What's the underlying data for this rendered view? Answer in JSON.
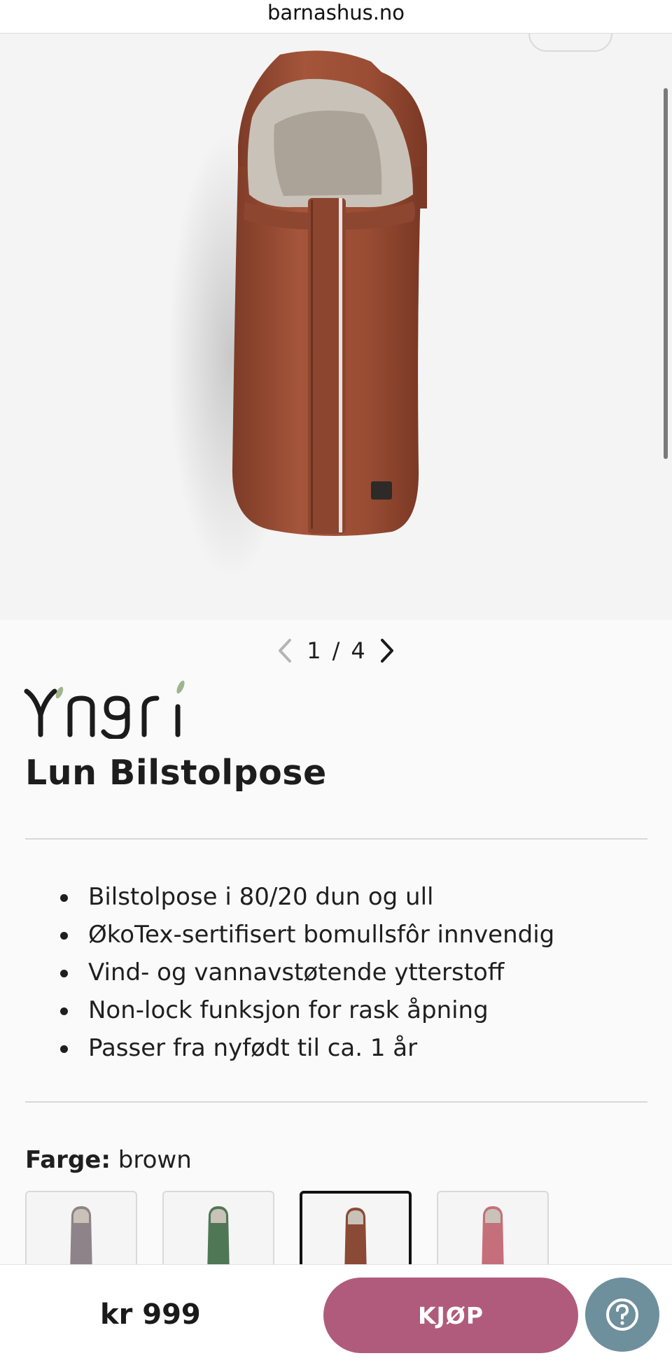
{
  "browser": {
    "url": "barnashus.no"
  },
  "gallery": {
    "current": "1",
    "separator": "/",
    "total": "4"
  },
  "product": {
    "brand": "Yngri",
    "title": "Lun Bilstolpose",
    "features": [
      "Bilstolpose i 80/20 dun og ull",
      "ØkoTex-sertifisert bomullsfôr innvendig",
      "Vind- og vannavstøtende ytterstoff",
      "Non-lock funksjon for rask åpning",
      "Passer fra nyfødt til ca. 1 år"
    ],
    "color_label": "Farge:",
    "color_value": "brown",
    "swatches": [
      {
        "color": "#8e8389",
        "selected": false
      },
      {
        "color": "#4f7756",
        "selected": false
      },
      {
        "color": "#8a4a35",
        "selected": true
      },
      {
        "color": "#c46f7a",
        "selected": false
      }
    ]
  },
  "footer": {
    "price": "kr 999",
    "buy_label": "KJØP"
  },
  "colors": {
    "accent": "#b05b7b",
    "help": "#6e8f9c",
    "product_brown": "#9a4f37"
  }
}
